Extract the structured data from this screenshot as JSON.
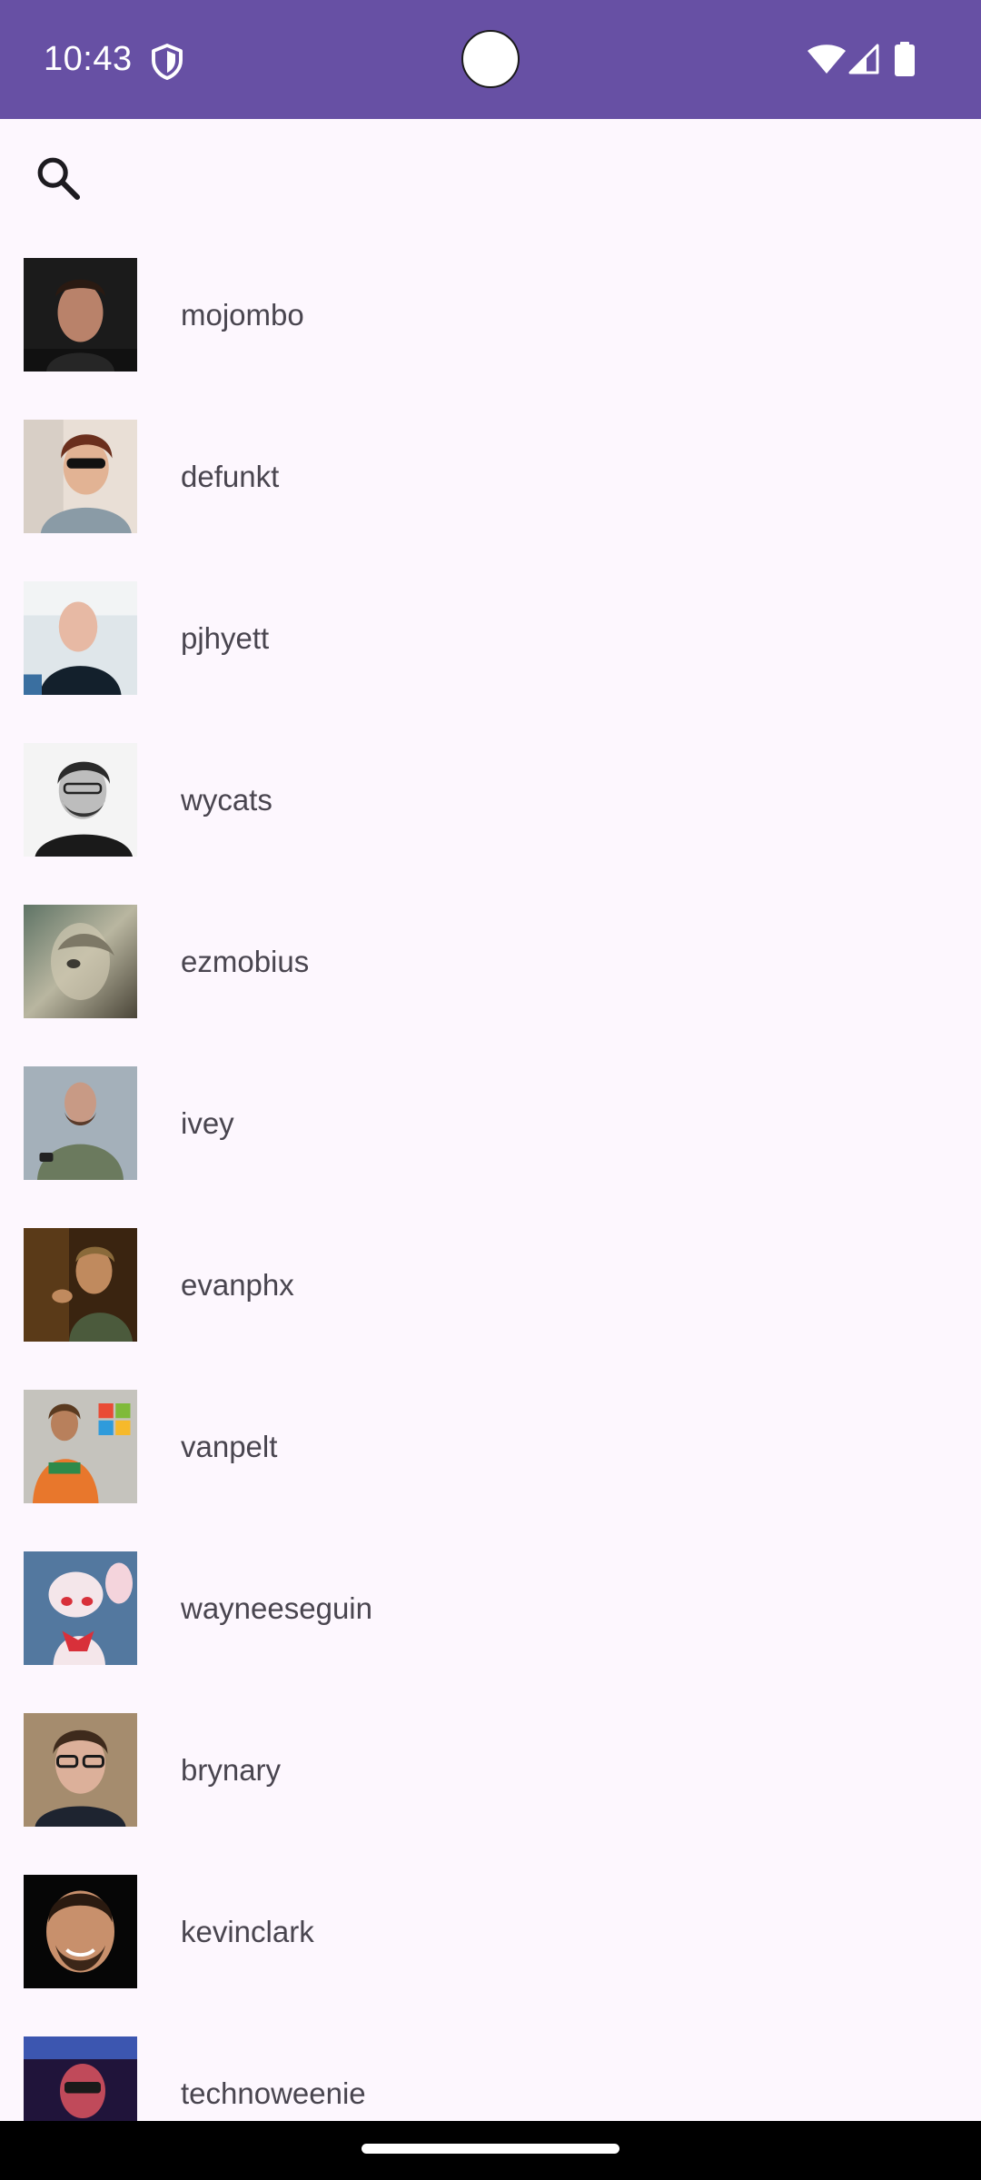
{
  "status_bar": {
    "time": "10:43",
    "icons": [
      "shield-icon",
      "wifi-icon",
      "signal-icon",
      "battery-icon"
    ],
    "background": "#6750a4"
  },
  "toolbar": {
    "search_icon": "search-icon"
  },
  "users": [
    {
      "login": "mojombo"
    },
    {
      "login": "defunkt"
    },
    {
      "login": "pjhyett"
    },
    {
      "login": "wycats"
    },
    {
      "login": "ezmobius"
    },
    {
      "login": "ivey"
    },
    {
      "login": "evanphx"
    },
    {
      "login": "vanpelt"
    },
    {
      "login": "wayneeseguin"
    },
    {
      "login": "brynary"
    },
    {
      "login": "kevinclark"
    },
    {
      "login": "technoweenie"
    }
  ],
  "colors": {
    "background": "#fdf7fe",
    "text": "#49454f",
    "accent": "#6750a4"
  }
}
